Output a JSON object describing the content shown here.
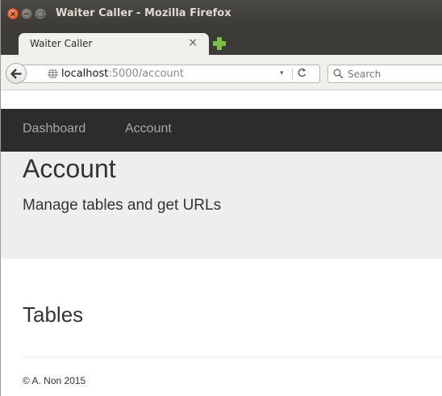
{
  "window": {
    "title": "Waiter Caller - Mozilla Firefox",
    "controls": {
      "close_glyph": "×",
      "minimize_glyph": "−",
      "maximize_glyph": "□"
    }
  },
  "tabs": [
    {
      "label": "Waiter Caller",
      "close_glyph": "×",
      "active": true
    }
  ],
  "new_tab_icon": "plus-icon",
  "navigation": {
    "back_icon": "back-arrow-icon",
    "url": {
      "host": "localhost",
      "rest": ":5000/account"
    },
    "dropdown_glyph": "▾",
    "reload_glyph": "C",
    "search": {
      "placeholder": "Search"
    }
  },
  "site": {
    "nav_links": [
      "Dashboard",
      "Account"
    ],
    "header": {
      "title": "Account",
      "subtitle": "Manage tables and get URLs"
    },
    "section_heading": "Tables",
    "footer": "© A. Non 2015"
  },
  "colors": {
    "titlebar": "#3c3b37",
    "site_nav": "#2c2c2c",
    "jumbotron": "#eeeeee",
    "new_tab_plus": "#7cc142",
    "close_button": "#e2541c"
  }
}
